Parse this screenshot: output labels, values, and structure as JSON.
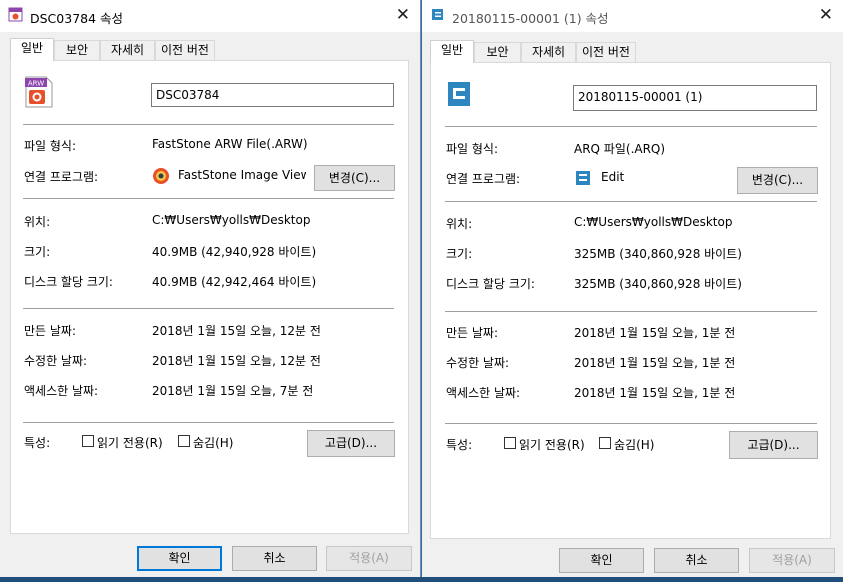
{
  "window1": {
    "title": "DSC03784 속성",
    "tabs": [
      "일반",
      "보안",
      "자세히",
      "이전 버전"
    ],
    "file_name": "DSC03784",
    "file_type_label": "파일 형식:",
    "file_type_value": "FastStone ARW File(.ARW)",
    "opens_with_label": "연결 프로그램:",
    "opens_with_value": "FastStone Image Viewer",
    "change_button": "변경(C)...",
    "location_label": "위치:",
    "location_value": "C:₩Users₩yolls₩Desktop",
    "size_label": "크기:",
    "size_value": "40.9MB (42,940,928 바이트)",
    "disk_size_label": "디스크 할당 크기:",
    "disk_size_value": "40.9MB (42,942,464 바이트)",
    "created_label": "만든 날짜:",
    "created_value": "2018년 1월 15일 오늘, 12분 전",
    "modified_label": "수정한 날짜:",
    "modified_value": "2018년 1월 15일 오늘, 12분 전",
    "accessed_label": "액세스한 날짜:",
    "accessed_value": "2018년 1월 15일 오늘, 7분 전",
    "attributes_label": "특성:",
    "readonly_label": "읽기 전용(R)",
    "hidden_label": "숨김(H)",
    "advanced_button": "고급(D)...",
    "ok_button": "확인",
    "cancel_button": "취소",
    "apply_button": "적용(A)",
    "file_icon_text": "ARW"
  },
  "window2": {
    "title": "20180115-00001 (1) 속성",
    "tabs": [
      "일반",
      "보안",
      "자세히",
      "이전 버전"
    ],
    "file_name": "20180115-00001 (1)",
    "file_type_label": "파일 형식:",
    "file_type_value": "ARQ 파일(.ARQ)",
    "opens_with_label": "연결 프로그램:",
    "opens_with_value": "Edit",
    "change_button": "변경(C)...",
    "location_label": "위치:",
    "location_value": "C:₩Users₩yolls₩Desktop",
    "size_label": "크기:",
    "size_value": "325MB (340,860,928 바이트)",
    "disk_size_label": "디스크 할당 크기:",
    "disk_size_value": "325MB (340,860,928 바이트)",
    "created_label": "만든 날짜:",
    "created_value": "2018년 1월 15일 오늘, 1분 전",
    "modified_label": "수정한 날짜:",
    "modified_value": "2018년 1월 15일 오늘, 1분 전",
    "accessed_label": "액세스한 날짜:",
    "accessed_value": "2018년 1월 15일 오늘, 1분 전",
    "attributes_label": "특성:",
    "readonly_label": "읽기 전용(R)",
    "hidden_label": "숨김(H)",
    "advanced_button": "고급(D)...",
    "ok_button": "확인",
    "cancel_button": "취소",
    "apply_button": "적용(A)"
  },
  "icons": {
    "close": "close-icon",
    "arw_file": "arw-file-icon",
    "arq_file": "arq-file-icon",
    "faststone": "faststone-app-icon",
    "edit_app": "edit-app-icon"
  },
  "colors": {
    "accent": "#0078d7",
    "panel": "#ffffff",
    "window": "#f0f0f0",
    "arq_icon": "#2e86c1",
    "arw_icon": "#e8502a"
  }
}
